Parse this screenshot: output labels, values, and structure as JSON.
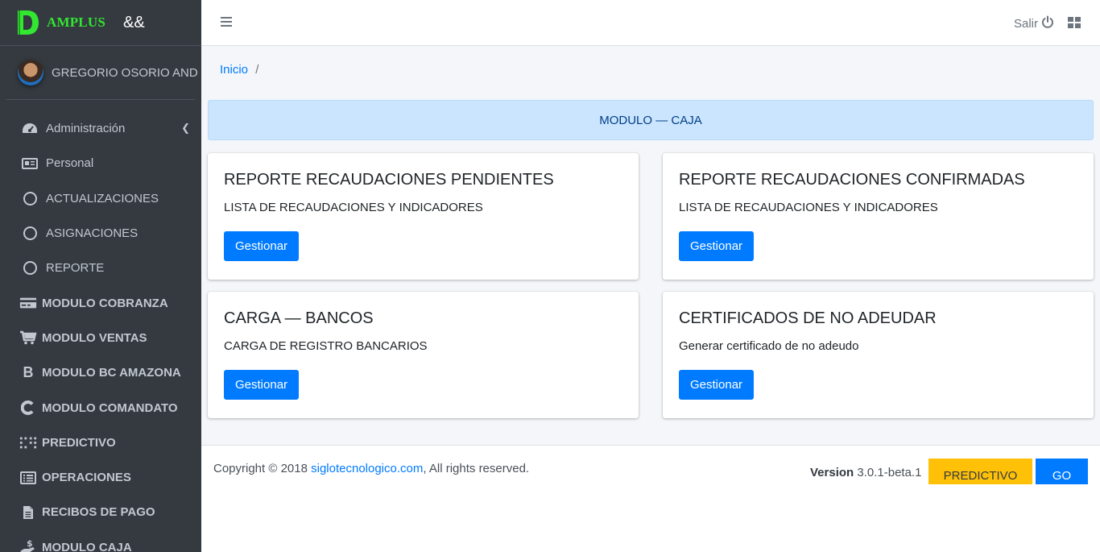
{
  "brand": {
    "name": "AMPLUS",
    "extra": "&&"
  },
  "user": {
    "name": "GREGORIO OSORIO AND"
  },
  "sidebar": {
    "items": [
      {
        "label": "Administración",
        "icon": "tachometer-icon"
      },
      {
        "label": "Personal",
        "icon": "id-card-icon"
      },
      {
        "label": "ACTUALIZACIONES",
        "icon": "circle-icon"
      },
      {
        "label": "ASIGNACIONES",
        "icon": "circle-icon"
      },
      {
        "label": "REPORTE",
        "icon": "circle-icon"
      },
      {
        "label": "MODULO COBRANZA",
        "icon": "credit-card-icon"
      },
      {
        "label": "MODULO VENTAS",
        "icon": "cart-icon"
      },
      {
        "label": "MODULO BC AMAZONA",
        "icon": "bold-b-icon"
      },
      {
        "label": "MODULO COMANDATO",
        "icon": "c-icon"
      },
      {
        "label": "PREDICTIVO",
        "icon": "dots-grid-icon"
      },
      {
        "label": "OPERACIONES",
        "icon": "list-icon"
      },
      {
        "label": "RECIBOS DE PAGO",
        "icon": "file-icon"
      },
      {
        "label": "MODULO CAJA",
        "icon": "hand-dollar-icon"
      }
    ]
  },
  "header": {
    "logout_label": "Salir"
  },
  "breadcrumb": {
    "home": "Inicio",
    "separator": "/"
  },
  "banner": {
    "text": "MODULO — CAJA"
  },
  "cards": [
    {
      "title": "REPORTE RECAUDACIONES PENDIENTES",
      "text": "LISTA DE RECAUDACIONES Y INDICADORES",
      "button": "Gestionar"
    },
    {
      "title": "REPORTE RECAUDACIONES CONFIRMADAS",
      "text": "LISTA DE RECAUDACIONES Y INDICADORES",
      "button": "Gestionar"
    },
    {
      "title": "CARGA — BANCOS",
      "text": "CARGA DE REGISTRO BANCARIOS",
      "button": "Gestionar"
    },
    {
      "title": "CERTIFICADOS DE NO ADEUDAR",
      "text": "Generar certificado de no adeudo",
      "button": "Gestionar"
    }
  ],
  "footer": {
    "copyright_prefix": "Copyright © 2018",
    "link": "siglotecnologico.com",
    "copyright_suffix": ", All rights reserved.",
    "version_label": "Version",
    "version_value": "3.0.1-beta.1",
    "predictivo_button": "PREDICTIVO",
    "go_button": "GO"
  },
  "colors": {
    "sidebar_bg": "#343a40",
    "brand_green": "#32e632",
    "primary": "#007bff",
    "banner_bg": "#cce5ff",
    "warning": "#ffc107",
    "content_bg": "#f4f6f9"
  }
}
